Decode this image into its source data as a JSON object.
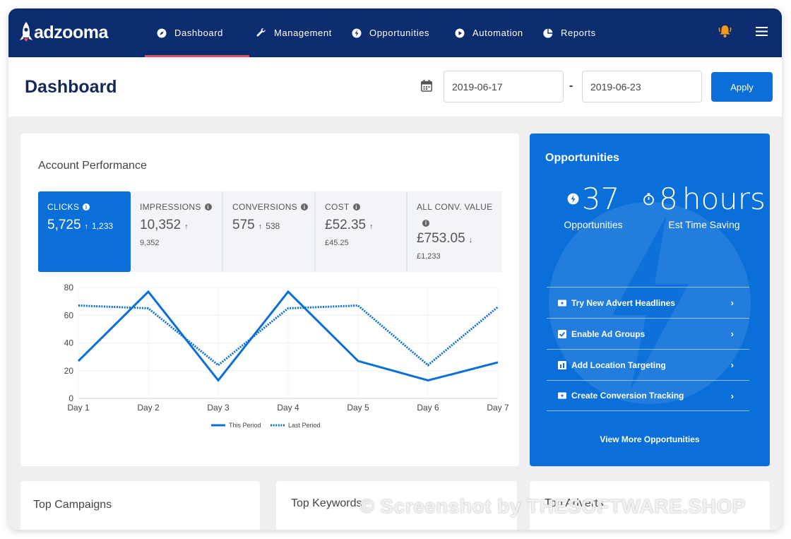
{
  "brand": {
    "name": "adzooma"
  },
  "nav": {
    "items": [
      {
        "label": "Dashboard",
        "icon": "compass-icon"
      },
      {
        "label": "Management",
        "icon": "wrench-icon"
      },
      {
        "label": "Opportunities",
        "icon": "bolt-icon"
      },
      {
        "label": "Automation",
        "icon": "play-icon"
      },
      {
        "label": "Reports",
        "icon": "pie-icon"
      }
    ],
    "active": "Dashboard",
    "right_icons": [
      "bell-icon",
      "menu-icon"
    ]
  },
  "header": {
    "title": "Dashboard",
    "date_from": "2019-06-17",
    "date_to": "2019-06-23",
    "separator": "-",
    "apply_label": "Apply"
  },
  "performance": {
    "title": "Account Performance",
    "metrics": [
      {
        "label": "CLICKS",
        "value": "5,725",
        "trend": "↑",
        "previous": "1,233",
        "active": true
      },
      {
        "label": "IMPRESSIONS",
        "value": "10,352",
        "trend": "↑",
        "previous": "9,352",
        "active": false
      },
      {
        "label": "CONVERSIONS",
        "value": "575",
        "trend": "↑",
        "previous": "538",
        "active": false
      },
      {
        "label": "COST",
        "value": "£52.35",
        "trend": "↑",
        "previous": "£45.25",
        "active": false
      },
      {
        "label": "ALL CONV. VALUE",
        "value": "£753.05",
        "trend": "↓",
        "previous": "£1,233",
        "active": false
      }
    ]
  },
  "chart_data": {
    "type": "line",
    "categories": [
      "Day 1",
      "Day 2",
      "Day 3",
      "Day 4",
      "Day 5",
      "Day 6",
      "Day 7"
    ],
    "series": [
      {
        "name": "This Period",
        "values": [
          27,
          77,
          13,
          77,
          27,
          13,
          26
        ],
        "style": "solid",
        "color": "#0a6fd8"
      },
      {
        "name": "Last Period",
        "values": [
          67,
          65,
          24,
          65,
          67,
          24,
          66
        ],
        "style": "dotted",
        "color": "#0a6fd8"
      }
    ],
    "yticks": [
      0,
      20,
      40,
      60,
      80
    ],
    "ylim": [
      0,
      80
    ],
    "grid": true,
    "legend_position": "bottom"
  },
  "opportunities": {
    "title": "Opportunities",
    "count": "37",
    "count_label": "Opportunities",
    "time_value": "8",
    "time_unit": "hours",
    "time_label": "Est Time Saving",
    "items": [
      {
        "label": "Try New Advert Headlines",
        "icon": "ticket-icon"
      },
      {
        "label": "Enable Ad Groups",
        "icon": "checkbox-icon"
      },
      {
        "label": "Add Location Targeting",
        "icon": "map-pin-icon"
      },
      {
        "label": "Create Conversion Tracking",
        "icon": "ticket-icon"
      }
    ],
    "more_label": "View More Opportunities"
  },
  "bottom": {
    "campaigns": "Top Campaigns",
    "keywords": "Top Keywords",
    "adverts": "Top Adverts"
  },
  "watermark": "© Screenshot by THESOFTWARE.SHOP",
  "colors": {
    "nav": "#0b2d6f",
    "accent": "#0a6fd8",
    "active_underline": "#e0525f"
  }
}
